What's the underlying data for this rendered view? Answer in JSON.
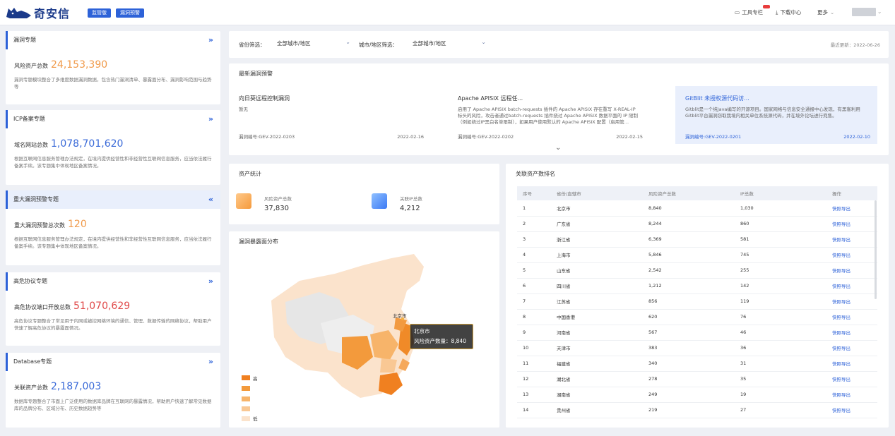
{
  "header": {
    "logo_text": "奇安信",
    "tags": [
      "监管版",
      "漏洞预警"
    ],
    "tools_label": "工具专栏",
    "download_label": "下载中心",
    "more_label": "更多"
  },
  "sidebar": [
    {
      "title": "漏洞专题",
      "metric_label": "风险资产总数",
      "metric_value": "24,153,390",
      "metric_color": "#f09a4a",
      "desc": "漏洞专题模块整合了多维度数据漏洞数据，包含热门漏洞清单、暴露面分布、漏洞影响范围与趋势等",
      "chev": "»"
    },
    {
      "title": "ICP备案专题",
      "metric_label": "域名网站总数",
      "metric_value": "1,078,701,620",
      "metric_color": "#3a6ad8",
      "desc": "根据互联网信息服务管理办法规定，在境内提供经营性和非经营性互联网信息服务，应当依法履行备案手续。该专题集中体现地区备案情况。",
      "chev": "»"
    },
    {
      "title": "重大漏洞预警专题",
      "metric_label": "重大漏洞预警总次数",
      "metric_value": "120",
      "metric_color": "#f09a4a",
      "desc": "根据互联网信息服务管理办法规定，在境内提供经营性和非经营性互联网信息服务，应当依法履行备案手续。该专题集中体现地区备案情况。",
      "chev": "«"
    },
    {
      "title": "高危协议专题",
      "metric_label": "高危协议端口开放总数",
      "metric_value": "51,070,629",
      "metric_color": "#e04a4a",
      "desc": "高危协议专题整合了常见用于内网或被控网络环境的通信、管理、数据传输的网络协议，帮助用户快速了解高危协议的暴露面情况。",
      "chev": "»"
    },
    {
      "title": "Database专题",
      "metric_label": "关联资产总数",
      "metric_value": "2,187,003",
      "metric_color": "#3a6ad8",
      "desc": "数据库专题整合了市面上广泛使用的数据库品牌在互联网的暴露情况，帮助用户快速了解常见数据库的品牌分布、区域分布、历史数据趋势等",
      "chev": "»"
    }
  ],
  "filter": {
    "province_label": "省份筛选：",
    "province_value": "全部城市/地区",
    "city_label": "城市/地区筛选：",
    "city_value": "全部城市/地区",
    "updated": "最近更新：2022-06-26"
  },
  "warnings": {
    "title": "最新漏洞预警",
    "items": [
      {
        "title": "向日葵远程控制漏洞",
        "desc": "暂无",
        "id": "漏洞编号:GEV-2022-0203",
        "date": "2022-02-16"
      },
      {
        "title": "Apache APISIX 远程任...",
        "desc": "启用了 Apache APISIX batch-requests 插件的 Apache APISIX 存在重写 X-REAL-IP 标头的风险，攻击者通过batch-requests 插件绕过 Apache APISIX 数据平面的 IP 限制（例如绕过IP黑白名单限制），如果用户使用默认的 Apache APISIX 配置（启用管...",
        "id": "漏洞编号:GEV-2022-0202",
        "date": "2022-02-15"
      },
      {
        "title": "GitBlit 未授权源代码访...",
        "desc": "Gitblit是一个纯Java编写的开源项目。国家网络与信息安全通报中心发现，有黑客利用Gitblit平台漏洞窃取我境内相关单位系统源代码，并在境外论坛进行兜售。",
        "id": "漏洞编号:GEV-2022-0201",
        "date": "2022-02-10"
      }
    ]
  },
  "asset_stats": {
    "title": "资产统计",
    "risk_label": "风险资产总数",
    "risk_value": "37,830",
    "ip_label": "关联IP总数",
    "ip_value": "4,212"
  },
  "map": {
    "title": "漏洞暴露面分布",
    "tooltip_title": "北京市",
    "tooltip_text": "风险资产数量：8,840",
    "city_label": "北京市",
    "legend_high": "高",
    "legend_low": "低"
  },
  "ranking": {
    "title": "关联资产数排名",
    "columns": [
      "序号",
      "省份/直辖市",
      "风险资产总数",
      "IP总数",
      "操作"
    ],
    "rows": [
      [
        "1",
        "北京市",
        "8,840",
        "1,030",
        "快照导出"
      ],
      [
        "2",
        "广东省",
        "8,244",
        "860",
        "快照导出"
      ],
      [
        "3",
        "浙江省",
        "6,369",
        "581",
        "快照导出"
      ],
      [
        "4",
        "上海市",
        "5,846",
        "745",
        "快照导出"
      ],
      [
        "5",
        "山东省",
        "2,542",
        "255",
        "快照导出"
      ],
      [
        "6",
        "四川省",
        "1,212",
        "142",
        "快照导出"
      ],
      [
        "7",
        "江苏省",
        "856",
        "119",
        "快照导出"
      ],
      [
        "8",
        "中国香港",
        "620",
        "76",
        "快照导出"
      ],
      [
        "9",
        "河南省",
        "567",
        "46",
        "快照导出"
      ],
      [
        "10",
        "天津市",
        "383",
        "36",
        "快照导出"
      ],
      [
        "11",
        "福建省",
        "340",
        "31",
        "快照导出"
      ],
      [
        "12",
        "湖北省",
        "278",
        "35",
        "快照导出"
      ],
      [
        "13",
        "湖南省",
        "249",
        "19",
        "快照导出"
      ],
      [
        "14",
        "贵州省",
        "219",
        "27",
        "快照导出"
      ]
    ]
  }
}
